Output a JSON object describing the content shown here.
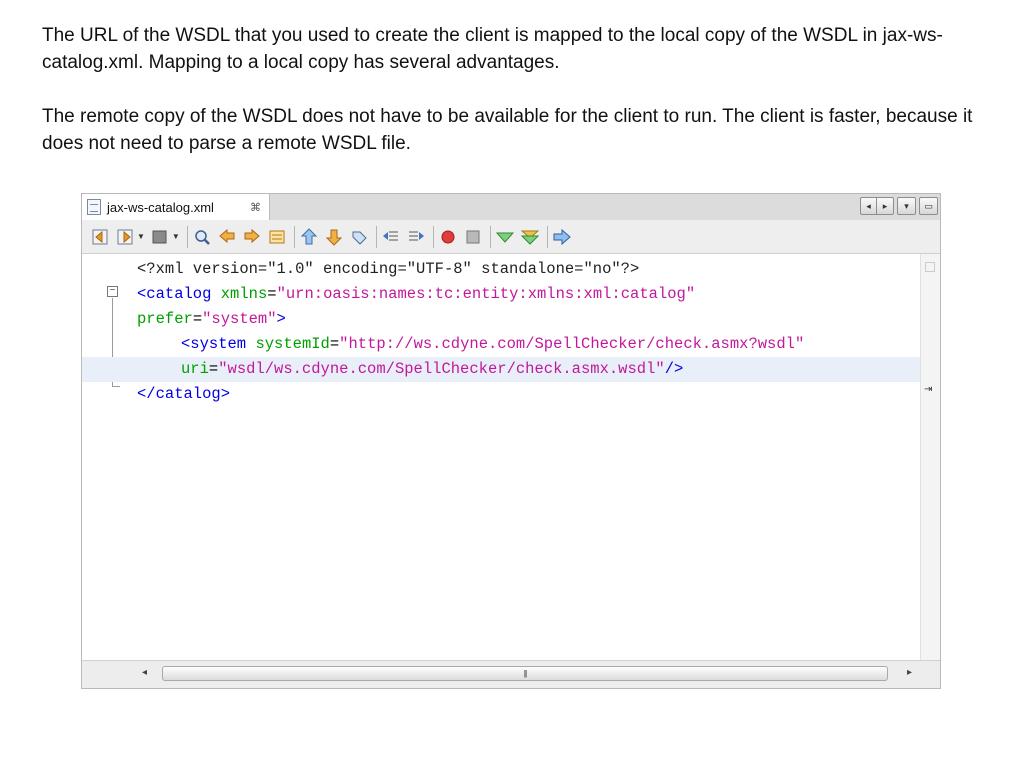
{
  "intro": {
    "paragraph1": "The URL of the WSDL that you used to create the client is mapped to the local copy of the WSDL in jax-ws-catalog.xml. Mapping to a local copy has several advantages.",
    "paragraph2": "The remote copy of the WSDL does not have to be available for the client to run. The client is faster, because it does not need to parse a remote WSDL file."
  },
  "ide": {
    "tab_label": "jax-ws-catalog.xml",
    "tab_close": "⌘",
    "window_controls": {
      "nav_left": "◂",
      "nav_right": "▸",
      "menu": "▾",
      "restore": "▭"
    },
    "toolbar_icons": [
      "back-history-icon",
      "forward-history-icon",
      "last-edit-icon",
      "find-icon",
      "find-previous-icon",
      "find-next-icon",
      "toggle-highlight-icon",
      "previous-bookmark-icon",
      "next-bookmark-icon",
      "toggle-bookmark-icon",
      "shift-left-icon",
      "shift-right-icon",
      "start-macro-icon",
      "stop-macro-icon",
      "check-xml-icon",
      "validate-xml-icon",
      "xsl-transform-icon"
    ],
    "code": {
      "l1_text": "<?xml version=\"1.0\" encoding=\"UTF-8\" standalone=\"no\"?>",
      "l2_open": "<catalog",
      "l2_attr": "xmlns",
      "l2_eq": "=",
      "l2_val": "\"urn:oasis:names:tc:entity:xmlns:xml:catalog\"",
      "l3_attr": "prefer",
      "l3_eq": "=",
      "l3_val": "\"system\"",
      "l3_close": ">",
      "l4_open": "<system",
      "l4_attr": "systemId",
      "l4_eq": "=",
      "l4_val": "\"http://ws.cdyne.com/SpellChecker/check.asmx?wsdl\"",
      "l5_attr": "uri",
      "l5_eq": "=",
      "l5_val": "\"wsdl/ws.cdyne.com/SpellChecker/check.asmx.wsdl\"",
      "l5_close": "/>",
      "l6_text": "</catalog>"
    },
    "fold_toggle": "−",
    "scroll_left": "◂",
    "scroll_right": "▸",
    "scroll_grip": "|||",
    "right_marker": "⇥"
  },
  "colors": {
    "tag": "#0000e6",
    "attribute": "#00a000",
    "value": "#c2189b",
    "current_line": "#e9eff8"
  }
}
